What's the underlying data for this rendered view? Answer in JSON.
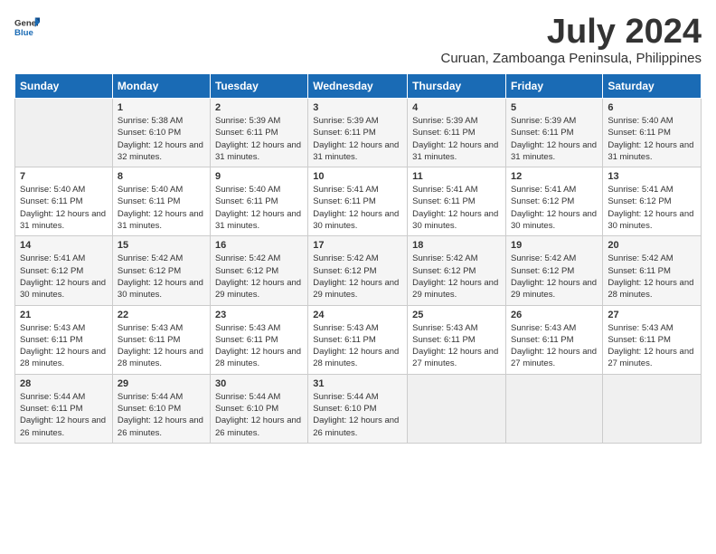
{
  "header": {
    "logo": {
      "general": "General",
      "blue": "Blue"
    },
    "title": "July 2024",
    "subtitle": "Curuan, Zamboanga Peninsula, Philippines"
  },
  "weekdays": [
    "Sunday",
    "Monday",
    "Tuesday",
    "Wednesday",
    "Thursday",
    "Friday",
    "Saturday"
  ],
  "weeks": [
    [
      {
        "day": "",
        "sunrise": "",
        "sunset": "",
        "daylight": ""
      },
      {
        "day": "1",
        "sunrise": "Sunrise: 5:38 AM",
        "sunset": "Sunset: 6:10 PM",
        "daylight": "Daylight: 12 hours and 32 minutes."
      },
      {
        "day": "2",
        "sunrise": "Sunrise: 5:39 AM",
        "sunset": "Sunset: 6:11 PM",
        "daylight": "Daylight: 12 hours and 31 minutes."
      },
      {
        "day": "3",
        "sunrise": "Sunrise: 5:39 AM",
        "sunset": "Sunset: 6:11 PM",
        "daylight": "Daylight: 12 hours and 31 minutes."
      },
      {
        "day": "4",
        "sunrise": "Sunrise: 5:39 AM",
        "sunset": "Sunset: 6:11 PM",
        "daylight": "Daylight: 12 hours and 31 minutes."
      },
      {
        "day": "5",
        "sunrise": "Sunrise: 5:39 AM",
        "sunset": "Sunset: 6:11 PM",
        "daylight": "Daylight: 12 hours and 31 minutes."
      },
      {
        "day": "6",
        "sunrise": "Sunrise: 5:40 AM",
        "sunset": "Sunset: 6:11 PM",
        "daylight": "Daylight: 12 hours and 31 minutes."
      }
    ],
    [
      {
        "day": "7",
        "sunrise": "Sunrise: 5:40 AM",
        "sunset": "Sunset: 6:11 PM",
        "daylight": "Daylight: 12 hours and 31 minutes."
      },
      {
        "day": "8",
        "sunrise": "Sunrise: 5:40 AM",
        "sunset": "Sunset: 6:11 PM",
        "daylight": "Daylight: 12 hours and 31 minutes."
      },
      {
        "day": "9",
        "sunrise": "Sunrise: 5:40 AM",
        "sunset": "Sunset: 6:11 PM",
        "daylight": "Daylight: 12 hours and 31 minutes."
      },
      {
        "day": "10",
        "sunrise": "Sunrise: 5:41 AM",
        "sunset": "Sunset: 6:11 PM",
        "daylight": "Daylight: 12 hours and 30 minutes."
      },
      {
        "day": "11",
        "sunrise": "Sunrise: 5:41 AM",
        "sunset": "Sunset: 6:11 PM",
        "daylight": "Daylight: 12 hours and 30 minutes."
      },
      {
        "day": "12",
        "sunrise": "Sunrise: 5:41 AM",
        "sunset": "Sunset: 6:12 PM",
        "daylight": "Daylight: 12 hours and 30 minutes."
      },
      {
        "day": "13",
        "sunrise": "Sunrise: 5:41 AM",
        "sunset": "Sunset: 6:12 PM",
        "daylight": "Daylight: 12 hours and 30 minutes."
      }
    ],
    [
      {
        "day": "14",
        "sunrise": "Sunrise: 5:41 AM",
        "sunset": "Sunset: 6:12 PM",
        "daylight": "Daylight: 12 hours and 30 minutes."
      },
      {
        "day": "15",
        "sunrise": "Sunrise: 5:42 AM",
        "sunset": "Sunset: 6:12 PM",
        "daylight": "Daylight: 12 hours and 30 minutes."
      },
      {
        "day": "16",
        "sunrise": "Sunrise: 5:42 AM",
        "sunset": "Sunset: 6:12 PM",
        "daylight": "Daylight: 12 hours and 29 minutes."
      },
      {
        "day": "17",
        "sunrise": "Sunrise: 5:42 AM",
        "sunset": "Sunset: 6:12 PM",
        "daylight": "Daylight: 12 hours and 29 minutes."
      },
      {
        "day": "18",
        "sunrise": "Sunrise: 5:42 AM",
        "sunset": "Sunset: 6:12 PM",
        "daylight": "Daylight: 12 hours and 29 minutes."
      },
      {
        "day": "19",
        "sunrise": "Sunrise: 5:42 AM",
        "sunset": "Sunset: 6:12 PM",
        "daylight": "Daylight: 12 hours and 29 minutes."
      },
      {
        "day": "20",
        "sunrise": "Sunrise: 5:42 AM",
        "sunset": "Sunset: 6:11 PM",
        "daylight": "Daylight: 12 hours and 28 minutes."
      }
    ],
    [
      {
        "day": "21",
        "sunrise": "Sunrise: 5:43 AM",
        "sunset": "Sunset: 6:11 PM",
        "daylight": "Daylight: 12 hours and 28 minutes."
      },
      {
        "day": "22",
        "sunrise": "Sunrise: 5:43 AM",
        "sunset": "Sunset: 6:11 PM",
        "daylight": "Daylight: 12 hours and 28 minutes."
      },
      {
        "day": "23",
        "sunrise": "Sunrise: 5:43 AM",
        "sunset": "Sunset: 6:11 PM",
        "daylight": "Daylight: 12 hours and 28 minutes."
      },
      {
        "day": "24",
        "sunrise": "Sunrise: 5:43 AM",
        "sunset": "Sunset: 6:11 PM",
        "daylight": "Daylight: 12 hours and 28 minutes."
      },
      {
        "day": "25",
        "sunrise": "Sunrise: 5:43 AM",
        "sunset": "Sunset: 6:11 PM",
        "daylight": "Daylight: 12 hours and 27 minutes."
      },
      {
        "day": "26",
        "sunrise": "Sunrise: 5:43 AM",
        "sunset": "Sunset: 6:11 PM",
        "daylight": "Daylight: 12 hours and 27 minutes."
      },
      {
        "day": "27",
        "sunrise": "Sunrise: 5:43 AM",
        "sunset": "Sunset: 6:11 PM",
        "daylight": "Daylight: 12 hours and 27 minutes."
      }
    ],
    [
      {
        "day": "28",
        "sunrise": "Sunrise: 5:44 AM",
        "sunset": "Sunset: 6:11 PM",
        "daylight": "Daylight: 12 hours and 26 minutes."
      },
      {
        "day": "29",
        "sunrise": "Sunrise: 5:44 AM",
        "sunset": "Sunset: 6:10 PM",
        "daylight": "Daylight: 12 hours and 26 minutes."
      },
      {
        "day": "30",
        "sunrise": "Sunrise: 5:44 AM",
        "sunset": "Sunset: 6:10 PM",
        "daylight": "Daylight: 12 hours and 26 minutes."
      },
      {
        "day": "31",
        "sunrise": "Sunrise: 5:44 AM",
        "sunset": "Sunset: 6:10 PM",
        "daylight": "Daylight: 12 hours and 26 minutes."
      },
      {
        "day": "",
        "sunrise": "",
        "sunset": "",
        "daylight": ""
      },
      {
        "day": "",
        "sunrise": "",
        "sunset": "",
        "daylight": ""
      },
      {
        "day": "",
        "sunrise": "",
        "sunset": "",
        "daylight": ""
      }
    ]
  ]
}
